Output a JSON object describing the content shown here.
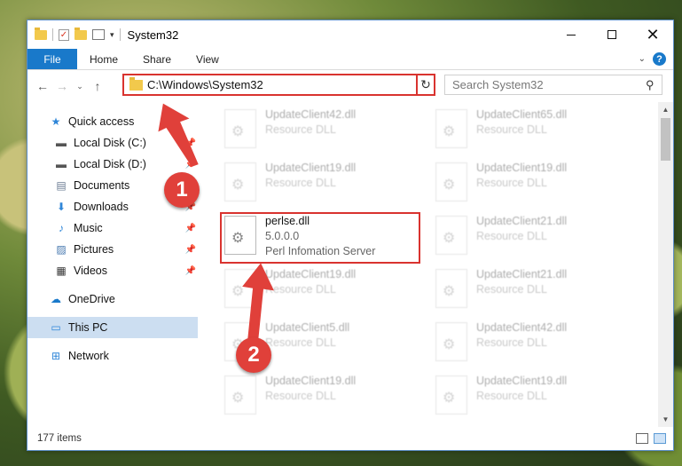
{
  "window": {
    "title": "System32"
  },
  "ribbon": {
    "tabs": [
      "File",
      "Home",
      "Share",
      "View"
    ]
  },
  "nav": {
    "address": "C:\\Windows\\System32",
    "search_placeholder": "Search System32"
  },
  "sidebar": {
    "quick_access": "Quick access",
    "items": [
      {
        "label": "Local Disk (C:)",
        "icon": "drive-icon",
        "pinned": true
      },
      {
        "label": "Local Disk (D:)",
        "icon": "drive-icon",
        "pinned": true
      },
      {
        "label": "Documents",
        "icon": "documents-icon",
        "pinned": true
      },
      {
        "label": "Downloads",
        "icon": "downloads-icon",
        "pinned": true
      },
      {
        "label": "Music",
        "icon": "music-icon",
        "pinned": true
      },
      {
        "label": "Pictures",
        "icon": "pictures-icon",
        "pinned": true
      },
      {
        "label": "Videos",
        "icon": "videos-icon",
        "pinned": true
      }
    ],
    "onedrive": "OneDrive",
    "this_pc": "This PC",
    "network": "Network"
  },
  "files": [
    {
      "name": "UpdateClient42.dll",
      "sub": "Resource DLL"
    },
    {
      "name": "UpdateClient65.dll",
      "sub": "Resource DLL"
    },
    {
      "name": "UpdateClient19.dll",
      "sub": "Resource DLL"
    },
    {
      "name": "UpdateClient19.dll",
      "sub": "Resource DLL"
    },
    {
      "name": "perlse.dll",
      "version": "5.0.0.0",
      "sub": "Perl Infomation Server"
    },
    {
      "name": "UpdateClient21.dll",
      "sub": "Resource DLL"
    },
    {
      "name": "UpdateClient19.dll",
      "sub": "Resource DLL"
    },
    {
      "name": "UpdateClient21.dll",
      "sub": "Resource DLL"
    },
    {
      "name": "UpdateClient5.dll",
      "sub": "Resource DLL"
    },
    {
      "name": "UpdateClient42.dll",
      "sub": "Resource DLL"
    },
    {
      "name": "UpdateClient19.dll",
      "sub": "Resource DLL"
    },
    {
      "name": "UpdateClient19.dll",
      "sub": "Resource DLL"
    }
  ],
  "status": {
    "items": "177 items"
  },
  "annotations": {
    "step1": "1",
    "step2": "2",
    "color": "#e0403a"
  }
}
